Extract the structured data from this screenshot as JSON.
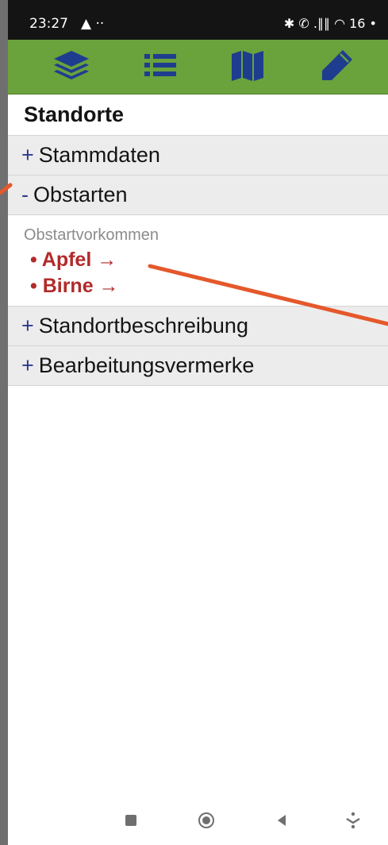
{
  "status_bar": {
    "time": "23:27",
    "indicators": "✱ ✆ .∥∥ ◠ 16 •",
    "battery_level": "16"
  },
  "toolbar": {
    "icons": [
      "layers-icon",
      "list-icon",
      "map-icon",
      "pencil-icon"
    ]
  },
  "page": {
    "title": "Standorte"
  },
  "sections": [
    {
      "sign": "+",
      "label": "Stammdaten",
      "expanded": false
    },
    {
      "sign": "-",
      "label": "Obstarten",
      "expanded": true,
      "sublabel": "Obstartvorkommen",
      "items": [
        "• Apfel →",
        "• Birne →"
      ]
    },
    {
      "sign": "+",
      "label": "Standortbeschreibung",
      "expanded": false
    },
    {
      "sign": "+",
      "label": "Bearbeitungsvermerke",
      "expanded": false
    }
  ],
  "nav_bar": {
    "icons": [
      "recent-apps-icon",
      "home-icon",
      "back-icon",
      "assistant-icon"
    ]
  },
  "colors": {
    "toolbar_bg": "#6aa23c",
    "toolbar_icon": "#1e3d8f",
    "link_red": "#b22a2a",
    "sign_blue": "#2e3a8c",
    "annotation_orange": "#e4582b"
  }
}
